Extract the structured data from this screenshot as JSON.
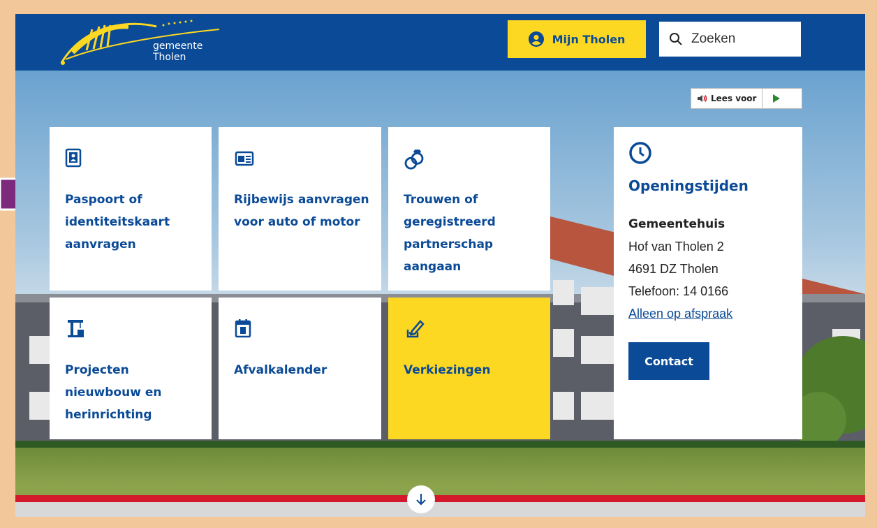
{
  "header": {
    "logo_text": "gemeente Tholen",
    "mijn_label": "Mijn Tholen",
    "search_placeholder": "Zoeken"
  },
  "read_aloud": {
    "label": "Lees voor"
  },
  "tiles": [
    {
      "title": "Paspoort of identiteitskaart aanvragen",
      "icon": "passport-icon"
    },
    {
      "title": "Rijbewijs aanvragen voor auto of motor",
      "icon": "id-card-icon"
    },
    {
      "title": "Trouwen of geregistreerd partnerschap aangaan",
      "icon": "rings-icon"
    },
    {
      "title": "Projecten nieuwbouw en herinrichting",
      "icon": "crane-icon"
    },
    {
      "title": "Afvalkalender",
      "icon": "calendar-icon"
    },
    {
      "title": "Verkiezingen",
      "icon": "ballot-icon"
    }
  ],
  "opening": {
    "title": "Openingstijden",
    "building": "Gemeentehuis",
    "address1": "Hof van Tholen 2",
    "address2": "4691 DZ Tholen",
    "phone": "Telefoon: 14 0166",
    "appointment_link": "Alleen op afspraak",
    "contact_label": "Contact"
  },
  "colors": {
    "brand_blue": "#0a4a96",
    "accent_yellow": "#fdd823",
    "footer_red": "#d3182b",
    "frame_border": "#f2c89a",
    "pointer_purple": "#7b2a7e"
  }
}
